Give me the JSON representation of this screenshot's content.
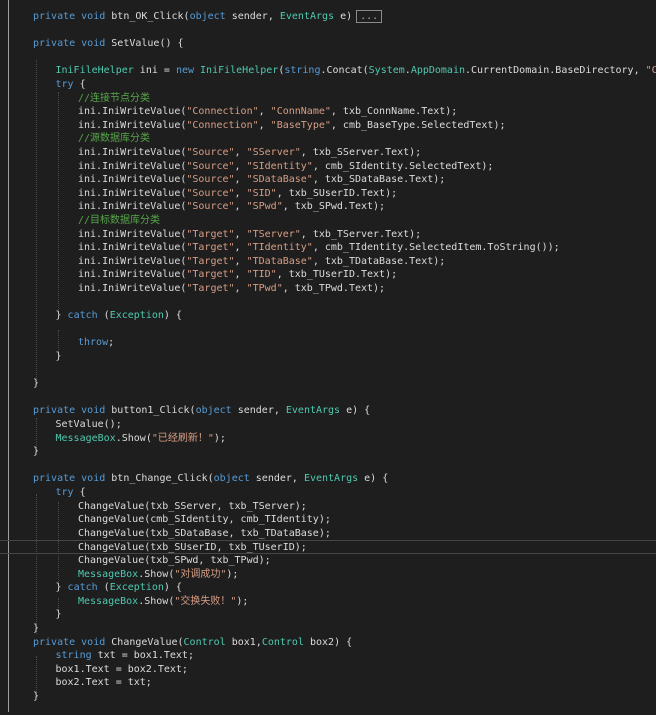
{
  "editor": {
    "lines": [
      {
        "row": 1,
        "indent": 0,
        "tokens": [
          [
            "kw",
            "private void "
          ],
          [
            "tx",
            "btn_OK_Click("
          ],
          [
            "kw",
            "object"
          ],
          [
            "tx",
            " sender, "
          ],
          [
            "ty",
            "EventArgs"
          ],
          [
            "tx",
            " e)"
          ]
        ],
        "collapsed": "..."
      },
      {
        "row": 3,
        "indent": 0,
        "tokens": [
          [
            "kw",
            "private void "
          ],
          [
            "tx",
            "SetValue() {"
          ]
        ]
      },
      {
        "row": 5,
        "indent": 1,
        "tokens": [
          [
            "ty",
            "IniFileHelper"
          ],
          [
            "tx",
            " ini = "
          ],
          [
            "kw",
            "new "
          ],
          [
            "ty",
            "IniFileHelper"
          ],
          [
            "tx",
            "("
          ],
          [
            "kw",
            "string"
          ],
          [
            "tx",
            "."
          ],
          [
            "tx",
            "Concat("
          ],
          [
            "ty",
            "System"
          ],
          [
            "tx",
            "."
          ],
          [
            "ty",
            "AppDomain"
          ],
          [
            "tx",
            ".CurrentDomain.BaseDirectory, "
          ],
          [
            "st",
            "\"Config.in"
          ]
        ]
      },
      {
        "row": 6,
        "indent": 1,
        "tokens": [
          [
            "kw",
            "try"
          ],
          [
            "tx",
            " {"
          ]
        ]
      },
      {
        "row": 7,
        "indent": 2,
        "tokens": [
          [
            "cm",
            "//连接节点分类"
          ]
        ]
      },
      {
        "row": 8,
        "indent": 2,
        "tokens": [
          [
            "tx",
            "ini.IniWriteValue("
          ],
          [
            "st",
            "\"Connection\""
          ],
          [
            "tx",
            ", "
          ],
          [
            "st",
            "\"ConnName\""
          ],
          [
            "tx",
            ", txb_ConnName.Text);"
          ]
        ]
      },
      {
        "row": 9,
        "indent": 2,
        "tokens": [
          [
            "tx",
            "ini.IniWriteValue("
          ],
          [
            "st",
            "\"Connection\""
          ],
          [
            "tx",
            ", "
          ],
          [
            "st",
            "\"BaseType\""
          ],
          [
            "tx",
            ", cmb_BaseType.SelectedText);"
          ]
        ]
      },
      {
        "row": 10,
        "indent": 2,
        "tokens": [
          [
            "cm",
            "//源数据库分类"
          ]
        ]
      },
      {
        "row": 11,
        "indent": 2,
        "tokens": [
          [
            "tx",
            "ini.IniWriteValue("
          ],
          [
            "st",
            "\"Source\""
          ],
          [
            "tx",
            ", "
          ],
          [
            "st",
            "\"SServer\""
          ],
          [
            "tx",
            ", txb_SServer.Text);"
          ]
        ]
      },
      {
        "row": 12,
        "indent": 2,
        "tokens": [
          [
            "tx",
            "ini.IniWriteValue("
          ],
          [
            "st",
            "\"Source\""
          ],
          [
            "tx",
            ", "
          ],
          [
            "st",
            "\"SIdentity\""
          ],
          [
            "tx",
            ", cmb_SIdentity.SelectedText);"
          ]
        ]
      },
      {
        "row": 13,
        "indent": 2,
        "tokens": [
          [
            "tx",
            "ini.IniWriteValue("
          ],
          [
            "st",
            "\"Source\""
          ],
          [
            "tx",
            ", "
          ],
          [
            "st",
            "\"SDataBase\""
          ],
          [
            "tx",
            ", txb_SDataBase.Text);"
          ]
        ]
      },
      {
        "row": 14,
        "indent": 2,
        "tokens": [
          [
            "tx",
            "ini.IniWriteValue("
          ],
          [
            "st",
            "\"Source\""
          ],
          [
            "tx",
            ", "
          ],
          [
            "st",
            "\"SID\""
          ],
          [
            "tx",
            ", txb_SUserID.Text);"
          ]
        ]
      },
      {
        "row": 15,
        "indent": 2,
        "tokens": [
          [
            "tx",
            "ini.IniWriteValue("
          ],
          [
            "st",
            "\"Source\""
          ],
          [
            "tx",
            ", "
          ],
          [
            "st",
            "\"SPwd\""
          ],
          [
            "tx",
            ", txb_SPwd.Text);"
          ]
        ]
      },
      {
        "row": 16,
        "indent": 2,
        "tokens": [
          [
            "cm",
            "//目标数据库分类"
          ]
        ]
      },
      {
        "row": 17,
        "indent": 2,
        "tokens": [
          [
            "tx",
            "ini.IniWriteValue("
          ],
          [
            "st",
            "\"Target\""
          ],
          [
            "tx",
            ", "
          ],
          [
            "st",
            "\"TServer\""
          ],
          [
            "tx",
            ", txb_TServer.Text);"
          ]
        ]
      },
      {
        "row": 18,
        "indent": 2,
        "tokens": [
          [
            "tx",
            "ini.IniWriteValue("
          ],
          [
            "st",
            "\"Target\""
          ],
          [
            "tx",
            ", "
          ],
          [
            "st",
            "\"TIdentity\""
          ],
          [
            "tx",
            ", cmb_TIdentity.SelectedItem.ToString());"
          ]
        ]
      },
      {
        "row": 19,
        "indent": 2,
        "tokens": [
          [
            "tx",
            "ini.IniWriteValue("
          ],
          [
            "st",
            "\"Target\""
          ],
          [
            "tx",
            ", "
          ],
          [
            "st",
            "\"TDataBase\""
          ],
          [
            "tx",
            ", txb_TDataBase.Text);"
          ]
        ]
      },
      {
        "row": 20,
        "indent": 2,
        "tokens": [
          [
            "tx",
            "ini.IniWriteValue("
          ],
          [
            "st",
            "\"Target\""
          ],
          [
            "tx",
            ", "
          ],
          [
            "st",
            "\"TID\""
          ],
          [
            "tx",
            ", txb_TUserID.Text);"
          ]
        ]
      },
      {
        "row": 21,
        "indent": 2,
        "tokens": [
          [
            "tx",
            "ini.IniWriteValue("
          ],
          [
            "st",
            "\"Target\""
          ],
          [
            "tx",
            ", "
          ],
          [
            "st",
            "\"TPwd\""
          ],
          [
            "tx",
            ", txb_TPwd.Text);"
          ]
        ]
      },
      {
        "row": 23,
        "indent": 1,
        "tokens": [
          [
            "tx",
            "} "
          ],
          [
            "kw",
            "catch"
          ],
          [
            "tx",
            " ("
          ],
          [
            "ty",
            "Exception"
          ],
          [
            "tx",
            ") {"
          ]
        ]
      },
      {
        "row": 25,
        "indent": 2,
        "tokens": [
          [
            "kw",
            "throw"
          ],
          [
            "tx",
            ";"
          ]
        ]
      },
      {
        "row": 26,
        "indent": 1,
        "tokens": [
          [
            "tx",
            "}"
          ]
        ]
      },
      {
        "row": 28,
        "indent": 0,
        "tokens": [
          [
            "tx",
            "}"
          ]
        ]
      },
      {
        "row": 30,
        "indent": 0,
        "tokens": [
          [
            "kw",
            "private void "
          ],
          [
            "tx",
            "button1_Click("
          ],
          [
            "kw",
            "object"
          ],
          [
            "tx",
            " sender, "
          ],
          [
            "ty",
            "EventArgs"
          ],
          [
            "tx",
            " e) {"
          ]
        ]
      },
      {
        "row": 31,
        "indent": 1,
        "tokens": [
          [
            "tx",
            "SetValue();"
          ]
        ]
      },
      {
        "row": 32,
        "indent": 1,
        "tokens": [
          [
            "ty",
            "MessageBox"
          ],
          [
            "tx",
            ".Show("
          ],
          [
            "st",
            "\"已经刷新！\""
          ],
          [
            "tx",
            ");"
          ]
        ]
      },
      {
        "row": 33,
        "indent": 0,
        "tokens": [
          [
            "tx",
            "}"
          ]
        ]
      },
      {
        "row": 35,
        "indent": 0,
        "tokens": [
          [
            "kw",
            "private void "
          ],
          [
            "tx",
            "btn_Change_Click("
          ],
          [
            "kw",
            "object"
          ],
          [
            "tx",
            " sender, "
          ],
          [
            "ty",
            "EventArgs"
          ],
          [
            "tx",
            " e) {"
          ]
        ]
      },
      {
        "row": 36,
        "indent": 1,
        "tokens": [
          [
            "kw",
            "try"
          ],
          [
            "tx",
            " {"
          ]
        ]
      },
      {
        "row": 37,
        "indent": 2,
        "tokens": [
          [
            "tx",
            "ChangeValue(txb_SServer, txb_TServer);"
          ]
        ]
      },
      {
        "row": 38,
        "indent": 2,
        "tokens": [
          [
            "tx",
            "ChangeValue(cmb_SIdentity, cmb_TIdentity);"
          ]
        ]
      },
      {
        "row": 39,
        "indent": 2,
        "tokens": [
          [
            "tx",
            "ChangeValue(txb_SDataBase, txb_TDataBase);"
          ]
        ]
      },
      {
        "row": 40,
        "indent": 2,
        "tokens": [
          [
            "tx",
            "ChangeValue(txb_SUserID, txb_TUserID);"
          ]
        ],
        "current": true
      },
      {
        "row": 41,
        "indent": 2,
        "tokens": [
          [
            "tx",
            "ChangeValue(txb_SPwd, txb_TPwd);"
          ]
        ]
      },
      {
        "row": 42,
        "indent": 2,
        "tokens": [
          [
            "ty",
            "MessageBox"
          ],
          [
            "tx",
            ".Show("
          ],
          [
            "st",
            "\"对调成功\""
          ],
          [
            "tx",
            ");"
          ]
        ]
      },
      {
        "row": 43,
        "indent": 1,
        "tokens": [
          [
            "tx",
            "} "
          ],
          [
            "kw",
            "catch"
          ],
          [
            "tx",
            " ("
          ],
          [
            "ty",
            "Exception"
          ],
          [
            "tx",
            ") {"
          ]
        ]
      },
      {
        "row": 44,
        "indent": 2,
        "tokens": [
          [
            "ty",
            "MessageBox"
          ],
          [
            "tx",
            ".Show("
          ],
          [
            "st",
            "\"交换失败！\""
          ],
          [
            "tx",
            ");"
          ]
        ]
      },
      {
        "row": 45,
        "indent": 1,
        "tokens": [
          [
            "tx",
            "}"
          ]
        ]
      },
      {
        "row": 46,
        "indent": 0,
        "tokens": [
          [
            "tx",
            "}"
          ]
        ]
      },
      {
        "row": 47,
        "indent": 0,
        "tokens": [
          [
            "kw",
            "private void "
          ],
          [
            "tx",
            "ChangeValue("
          ],
          [
            "ty",
            "Control"
          ],
          [
            "tx",
            " box1,"
          ],
          [
            "ty",
            "Control"
          ],
          [
            "tx",
            " box2) {"
          ]
        ]
      },
      {
        "row": 48,
        "indent": 1,
        "tokens": [
          [
            "kw",
            "string"
          ],
          [
            "tx",
            " txt = box1.Text;"
          ]
        ]
      },
      {
        "row": 49,
        "indent": 1,
        "tokens": [
          [
            "tx",
            "box1.Text = box2.Text;"
          ]
        ]
      },
      {
        "row": 50,
        "indent": 1,
        "tokens": [
          [
            "tx",
            "box2.Text = txt;"
          ]
        ]
      },
      {
        "row": 51,
        "indent": 0,
        "tokens": [
          [
            "tx",
            "}"
          ]
        ]
      }
    ]
  }
}
